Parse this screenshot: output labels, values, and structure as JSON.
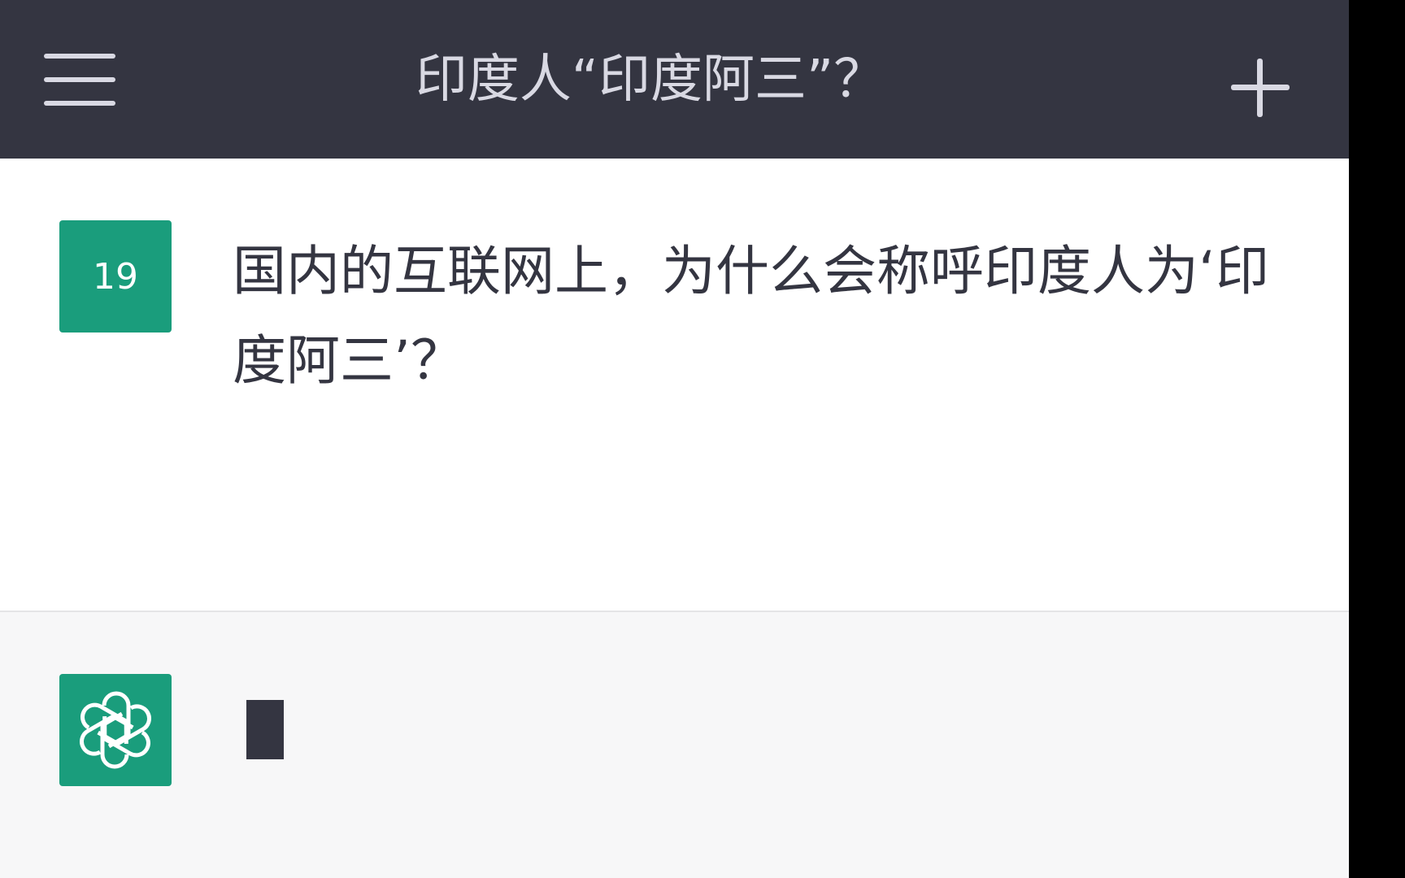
{
  "header": {
    "title": "印度人“印度阿三”？",
    "menu_icon": "hamburger-menu-icon",
    "new_chat_icon": "plus-icon",
    "background": "#343541"
  },
  "conversation": {
    "user_message": {
      "avatar_label": "19",
      "avatar_color": "#1a9d7c",
      "text": "国内的互联网上，为什么会称呼印度人为‘印度阿三’？"
    },
    "assistant_message": {
      "avatar_icon": "openai-logo-icon",
      "avatar_color": "#1a9d7c",
      "state": "typing-cursor"
    }
  }
}
